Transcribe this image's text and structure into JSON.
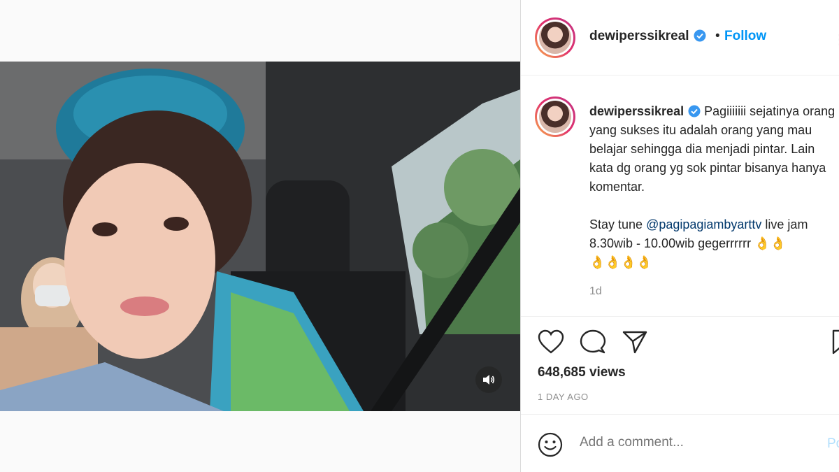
{
  "post": {
    "username": "dewiperssikreal",
    "follow_label": "Follow",
    "separator": "•",
    "more_label": "⋮"
  },
  "caption": {
    "username": "dewiperssikreal",
    "text_part1": " Pagiiiiiii sejatinya orang yang sukses itu adalah orang yang mau belajar sehingga dia menjadi pintar. Lain kata dg orang yg sok pintar bisanya hanya komentar.\n\nStay tune ",
    "mention": "@pagipagiambyarttv",
    "text_part2": " live jam 8.30wib - 10.00wib gegerrrrrr 👌👌\n👌👌👌👌",
    "time_ago": "1d"
  },
  "stats": {
    "views": "648,685 views",
    "date": "1 DAY AGO"
  },
  "comment": {
    "placeholder": "Add a comment...",
    "post_label": "Post"
  },
  "icons": {
    "like": "heart-icon",
    "comment": "comment-bubble-icon",
    "share": "paper-plane-icon",
    "save": "bookmark-icon",
    "emoji": "smiley-icon",
    "sound": "speaker-icon",
    "verified": "verified-badge-icon"
  },
  "colors": {
    "link_blue": "#0095f6",
    "mention_blue": "#00376b",
    "verified_blue": "#3897f0",
    "muted_grey": "#8e8e8e"
  }
}
